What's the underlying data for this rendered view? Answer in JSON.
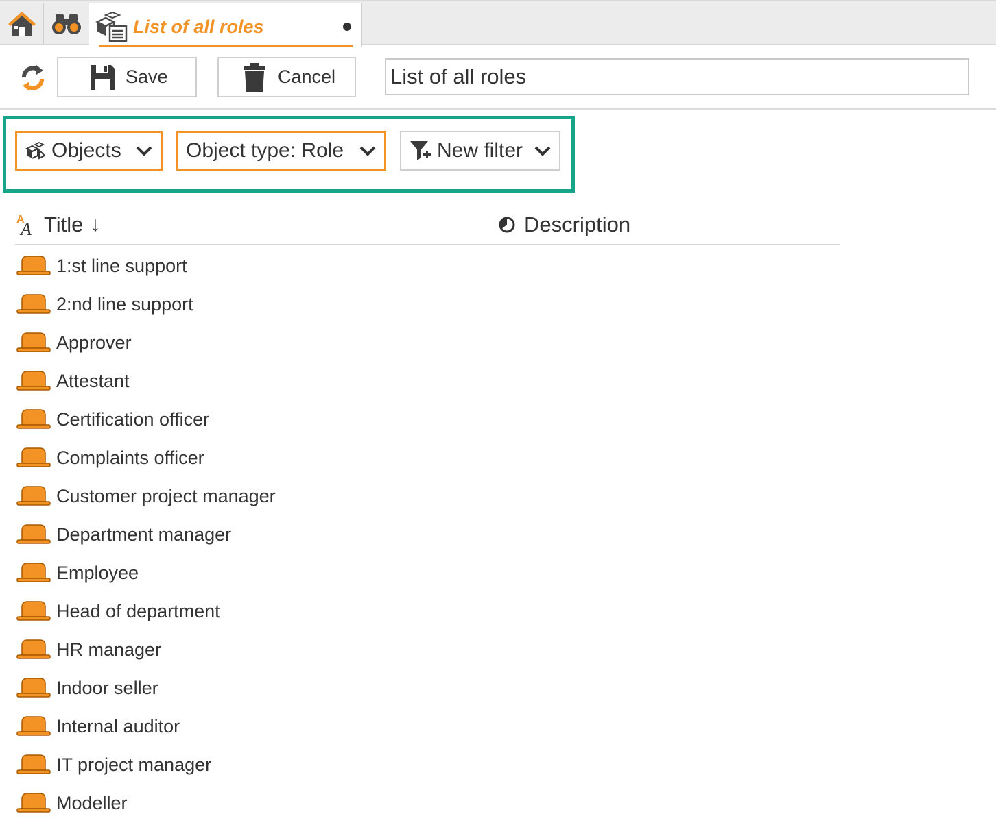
{
  "tabs": {
    "home_icon": "home-icon",
    "search_icon": "binoculars-icon",
    "active": {
      "title": "List of all roles",
      "icon": "object-list-icon",
      "modified_marker": "dot"
    }
  },
  "toolbar": {
    "refresh_icon": "refresh-icon",
    "save_label": "Save",
    "cancel_label": "Cancel",
    "title_value": "List of all roles"
  },
  "filters": {
    "objects_label": "Objects",
    "object_type_label": "Object type: Role",
    "new_filter_label": "New filter"
  },
  "columns": {
    "title_label": "Title",
    "title_sort": "↓",
    "description_label": "Description"
  },
  "rows": [
    "1:st line support",
    "2:nd line support",
    "Approver",
    "Attestant",
    "Certification officer",
    "Complaints officer",
    "Customer project manager",
    "Department manager",
    "Employee",
    "Head of department",
    "HR manager",
    "Indoor seller",
    "Internal auditor",
    "IT project manager",
    "Modeller"
  ],
  "colors": {
    "accent": "#f39325",
    "highlight_frame": "#16a589",
    "text": "#333333"
  }
}
